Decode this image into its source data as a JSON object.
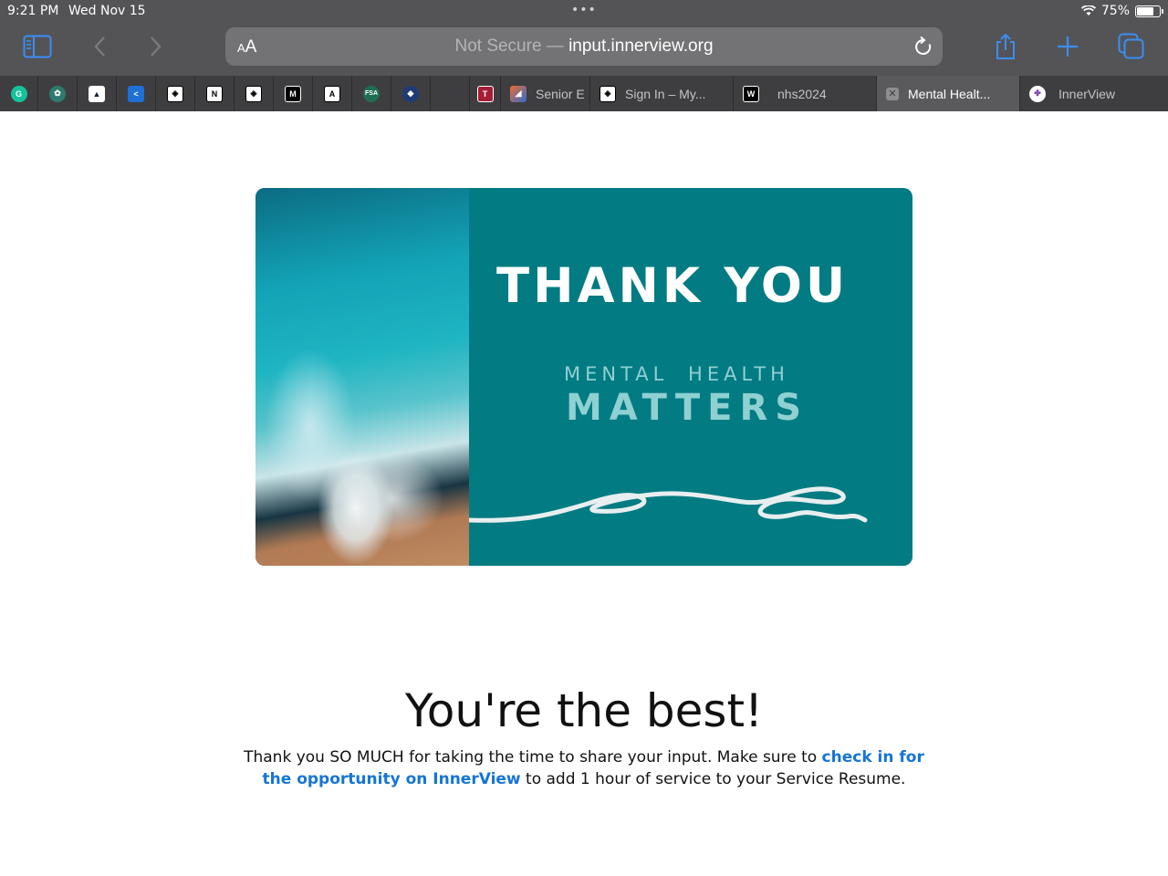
{
  "status_bar": {
    "time": "9:21 PM",
    "date": "Wed Nov 15",
    "dots": "•••",
    "battery_percent": "75%",
    "battery_level": 0.75
  },
  "toolbar": {
    "aa_small": "A",
    "aa_big": "A",
    "url_prefix": "Not Secure — ",
    "url_host": "input.innerview.org"
  },
  "tabs": {
    "labeled": [
      {
        "label": "Senior E"
      },
      {
        "label": "Sign In – My..."
      },
      {
        "label": "nhs2024"
      },
      {
        "label": "Mental Healt..."
      },
      {
        "label": "InnerView"
      }
    ],
    "favicon_texts": {
      "notion": "N",
      "m": "M",
      "a": "A",
      "fsa": "FSA",
      "t": "T",
      "w": "W"
    }
  },
  "card": {
    "title": "THANK YOU",
    "subtitle_line1": "MENTAL  HEALTH",
    "subtitle_line2": "MATTERS",
    "colors": {
      "teal": "#027b82",
      "accent": "#8fd0d2"
    }
  },
  "message": {
    "headline": "You're the best!",
    "body_before": "Thank you SO MUCH for taking the time to share your input. Make sure to ",
    "link_text": "check in for the opportunity on InnerView",
    "body_after": " to add 1 hour of service to your Service Resume.",
    "link_color": "#1575d6"
  }
}
